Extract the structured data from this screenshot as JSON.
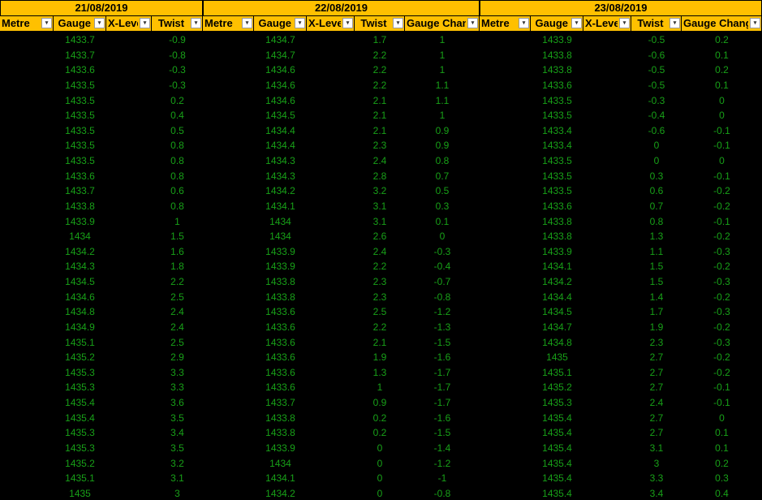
{
  "colors": {
    "header_bg": "#FFC000",
    "cell_bg": "#000000",
    "cell_text": "#18A018",
    "header_text": "#000000"
  },
  "icons": {
    "filter": "filter-dropdown-icon"
  },
  "filter_glyph": "▾",
  "blocks": [
    {
      "date": "21/08/2019",
      "headers": [
        "Metre",
        "Gauge",
        "X-Level",
        "Twist"
      ],
      "rows": [
        [
          "",
          "1433.7",
          "",
          "-0.9"
        ],
        [
          "",
          "1433.7",
          "",
          "-0.8"
        ],
        [
          "",
          "1433.6",
          "",
          "-0.3"
        ],
        [
          "",
          "1433.5",
          "",
          "-0.3"
        ],
        [
          "",
          "1433.5",
          "",
          "0.2"
        ],
        [
          "",
          "1433.5",
          "",
          "0.4"
        ],
        [
          "",
          "1433.5",
          "",
          "0.5"
        ],
        [
          "",
          "1433.5",
          "",
          "0.8"
        ],
        [
          "",
          "1433.5",
          "",
          "0.8"
        ],
        [
          "",
          "1433.6",
          "",
          "0.8"
        ],
        [
          "",
          "1433.7",
          "",
          "0.6"
        ],
        [
          "",
          "1433.8",
          "",
          "0.8"
        ],
        [
          "",
          "1433.9",
          "",
          "1"
        ],
        [
          "",
          "1434",
          "",
          "1.5"
        ],
        [
          "",
          "1434.2",
          "",
          "1.6"
        ],
        [
          "",
          "1434.3",
          "",
          "1.8"
        ],
        [
          "",
          "1434.5",
          "",
          "2.2"
        ],
        [
          "",
          "1434.6",
          "",
          "2.5"
        ],
        [
          "",
          "1434.8",
          "",
          "2.4"
        ],
        [
          "",
          "1434.9",
          "",
          "2.4"
        ],
        [
          "",
          "1435.1",
          "",
          "2.5"
        ],
        [
          "",
          "1435.2",
          "",
          "2.9"
        ],
        [
          "",
          "1435.3",
          "",
          "3.3"
        ],
        [
          "",
          "1435.3",
          "",
          "3.3"
        ],
        [
          "",
          "1435.4",
          "",
          "3.6"
        ],
        [
          "",
          "1435.4",
          "",
          "3.5"
        ],
        [
          "",
          "1435.3",
          "",
          "3.4"
        ],
        [
          "",
          "1435.3",
          "",
          "3.5"
        ],
        [
          "",
          "1435.2",
          "",
          "3.2"
        ],
        [
          "",
          "1435.1",
          "",
          "3.1"
        ],
        [
          "",
          "1435",
          "",
          "3"
        ]
      ]
    },
    {
      "date": "22/08/2019",
      "headers": [
        "Metre",
        "Gauge",
        "X-Level",
        "Twist",
        "Gauge Change"
      ],
      "rows": [
        [
          "",
          "1434.7",
          "",
          "1.7",
          "1"
        ],
        [
          "",
          "1434.7",
          "",
          "2.2",
          "1"
        ],
        [
          "",
          "1434.6",
          "",
          "2.2",
          "1"
        ],
        [
          "",
          "1434.6",
          "",
          "2.2",
          "1.1"
        ],
        [
          "",
          "1434.6",
          "",
          "2.1",
          "1.1"
        ],
        [
          "",
          "1434.5",
          "",
          "2.1",
          "1"
        ],
        [
          "",
          "1434.4",
          "",
          "2.1",
          "0.9"
        ],
        [
          "",
          "1434.4",
          "",
          "2.3",
          "0.9"
        ],
        [
          "",
          "1434.3",
          "",
          "2.4",
          "0.8"
        ],
        [
          "",
          "1434.3",
          "",
          "2.8",
          "0.7"
        ],
        [
          "",
          "1434.2",
          "",
          "3.2",
          "0.5"
        ],
        [
          "",
          "1434.1",
          "",
          "3.1",
          "0.3"
        ],
        [
          "",
          "1434",
          "",
          "3.1",
          "0.1"
        ],
        [
          "",
          "1434",
          "",
          "2.6",
          "0"
        ],
        [
          "",
          "1433.9",
          "",
          "2.4",
          "-0.3"
        ],
        [
          "",
          "1433.9",
          "",
          "2.2",
          "-0.4"
        ],
        [
          "",
          "1433.8",
          "",
          "2.3",
          "-0.7"
        ],
        [
          "",
          "1433.8",
          "",
          "2.3",
          "-0.8"
        ],
        [
          "",
          "1433.6",
          "",
          "2.5",
          "-1.2"
        ],
        [
          "",
          "1433.6",
          "",
          "2.2",
          "-1.3"
        ],
        [
          "",
          "1433.6",
          "",
          "2.1",
          "-1.5"
        ],
        [
          "",
          "1433.6",
          "",
          "1.9",
          "-1.6"
        ],
        [
          "",
          "1433.6",
          "",
          "1.3",
          "-1.7"
        ],
        [
          "",
          "1433.6",
          "",
          "1",
          "-1.7"
        ],
        [
          "",
          "1433.7",
          "",
          "0.9",
          "-1.7"
        ],
        [
          "",
          "1433.8",
          "",
          "0.2",
          "-1.6"
        ],
        [
          "",
          "1433.8",
          "",
          "0.2",
          "-1.5"
        ],
        [
          "",
          "1433.9",
          "",
          "0",
          "-1.4"
        ],
        [
          "",
          "1434",
          "",
          "0",
          "-1.2"
        ],
        [
          "",
          "1434.1",
          "",
          "0",
          "-1"
        ],
        [
          "",
          "1434.2",
          "",
          "0",
          "-0.8"
        ]
      ]
    },
    {
      "date": "23/08/2019",
      "headers": [
        "Metre",
        "Gauge",
        "X-Level",
        "Twist",
        "Gauge Change"
      ],
      "rows": [
        [
          "",
          "1433.9",
          "",
          "-0.5",
          "0.2"
        ],
        [
          "",
          "1433.8",
          "",
          "-0.6",
          "0.1"
        ],
        [
          "",
          "1433.8",
          "",
          "-0.5",
          "0.2"
        ],
        [
          "",
          "1433.6",
          "",
          "-0.5",
          "0.1"
        ],
        [
          "",
          "1433.5",
          "",
          "-0.3",
          "0"
        ],
        [
          "",
          "1433.5",
          "",
          "-0.4",
          "0"
        ],
        [
          "",
          "1433.4",
          "",
          "-0.6",
          "-0.1"
        ],
        [
          "",
          "1433.4",
          "",
          "0",
          "-0.1"
        ],
        [
          "",
          "1433.5",
          "",
          "0",
          "0"
        ],
        [
          "",
          "1433.5",
          "",
          "0.3",
          "-0.1"
        ],
        [
          "",
          "1433.5",
          "",
          "0.6",
          "-0.2"
        ],
        [
          "",
          "1433.6",
          "",
          "0.7",
          "-0.2"
        ],
        [
          "",
          "1433.8",
          "",
          "0.8",
          "-0.1"
        ],
        [
          "",
          "1433.8",
          "",
          "1.3",
          "-0.2"
        ],
        [
          "",
          "1433.9",
          "",
          "1.1",
          "-0.3"
        ],
        [
          "",
          "1434.1",
          "",
          "1.5",
          "-0.2"
        ],
        [
          "",
          "1434.2",
          "",
          "1.5",
          "-0.3"
        ],
        [
          "",
          "1434.4",
          "",
          "1.4",
          "-0.2"
        ],
        [
          "",
          "1434.5",
          "",
          "1.7",
          "-0.3"
        ],
        [
          "",
          "1434.7",
          "",
          "1.9",
          "-0.2"
        ],
        [
          "",
          "1434.8",
          "",
          "2.3",
          "-0.3"
        ],
        [
          "",
          "1435",
          "",
          "2.7",
          "-0.2"
        ],
        [
          "",
          "1435.1",
          "",
          "2.7",
          "-0.2"
        ],
        [
          "",
          "1435.2",
          "",
          "2.7",
          "-0.1"
        ],
        [
          "",
          "1435.3",
          "",
          "2.4",
          "-0.1"
        ],
        [
          "",
          "1435.4",
          "",
          "2.7",
          "0"
        ],
        [
          "",
          "1435.4",
          "",
          "2.7",
          "0.1"
        ],
        [
          "",
          "1435.4",
          "",
          "3.1",
          "0.1"
        ],
        [
          "",
          "1435.4",
          "",
          "3",
          "0.2"
        ],
        [
          "",
          "1435.4",
          "",
          "3.3",
          "0.3"
        ],
        [
          "",
          "1435.4",
          "",
          "3.4",
          "0.4"
        ]
      ]
    }
  ]
}
